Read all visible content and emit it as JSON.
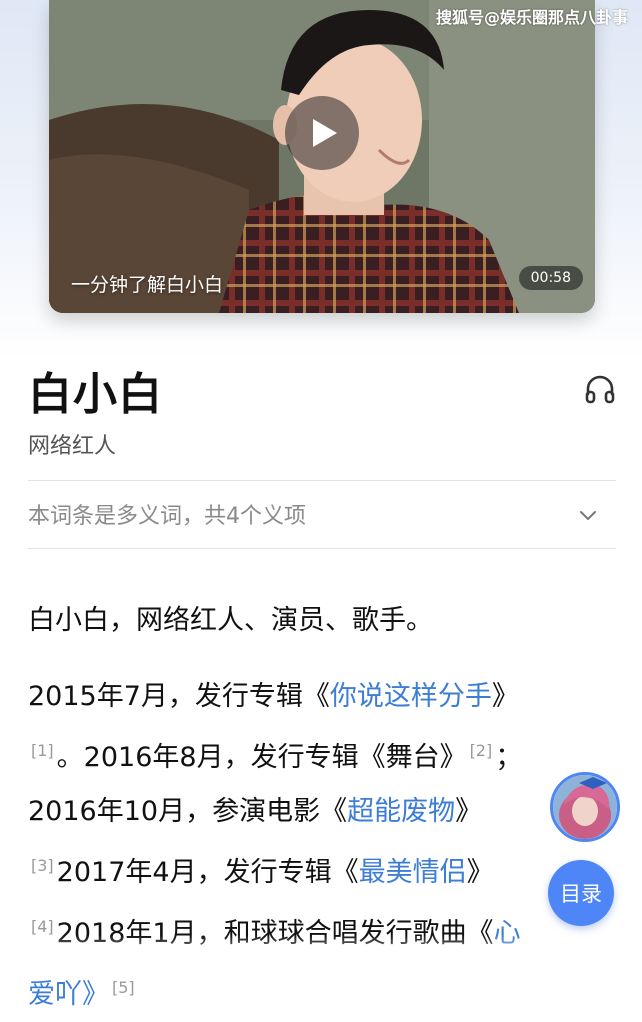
{
  "watermark": "搜狐号@娱乐圈那点八卦事",
  "video": {
    "caption": "一分钟了解白小白",
    "duration": "00:58",
    "play_icon": "play-icon"
  },
  "entry": {
    "title": "白小白",
    "subtitle": "网络红人",
    "audio_icon": "headphones-icon"
  },
  "polysemy": {
    "text": "本词条是多义词，共4个义项",
    "icon": "chevron-down-icon"
  },
  "summary": "白小白，网络红人、演员、歌手。",
  "body": {
    "l1_a": "2015年7月，发行专辑《",
    "l1_link": "你说这样分手",
    "l1_b": "》",
    "ref1": "[1]",
    "l2_a": "。2016年8月，发行专辑《舞台》",
    "ref2": "[2]",
    "l2_b": "；",
    "l3_a": "2016年10月，参演电影《",
    "l3_link": "超能废物",
    "l3_b": "》",
    "ref3": "[3]",
    "l4_a": "2017年4月，发行专辑《",
    "l4_link": "最美情侣",
    "l4_b": "》",
    "ref4": "[4]",
    "l5_a": "2018年1月，和球球合唱发行歌曲《",
    "l5_link": "心",
    "l6_a": "爱吖》",
    "ref5": "[5]"
  },
  "floating": {
    "toc_label": "目录"
  },
  "colors": {
    "link": "#3c7ed6",
    "toc_button": "#4e86f7"
  }
}
